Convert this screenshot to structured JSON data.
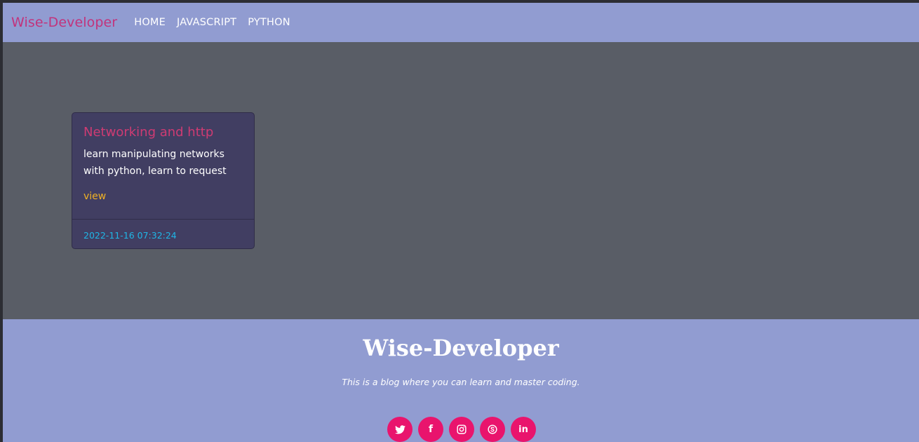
{
  "navbar": {
    "brand": "Wise-Developer",
    "links": [
      "HOME",
      "JAVASCRIPT",
      "PYTHON"
    ]
  },
  "card": {
    "title": "Networking and http",
    "text": "learn manipulating networks with python, learn to request",
    "link_label": "view",
    "date": "2022-11-16 07:32:24"
  },
  "footer": {
    "title": "Wise-Developer",
    "tagline": "This is a blog where you can learn and master coding.",
    "social": [
      {
        "icon": "twitter-icon"
      },
      {
        "icon": "facebook-icon",
        "glyph": "f"
      },
      {
        "icon": "instagram-icon"
      },
      {
        "icon": "skype-icon"
      },
      {
        "icon": "linkedin-icon",
        "glyph": "in"
      }
    ]
  },
  "colors": {
    "nav_bg": "#919cd1",
    "brand": "#c2337c",
    "main_bg": "#595d66",
    "card_bg": "#413e62",
    "card_title": "#cf3b73",
    "link": "#f1b224",
    "date": "#1fb6e6",
    "social_bg": "#e9146d"
  }
}
